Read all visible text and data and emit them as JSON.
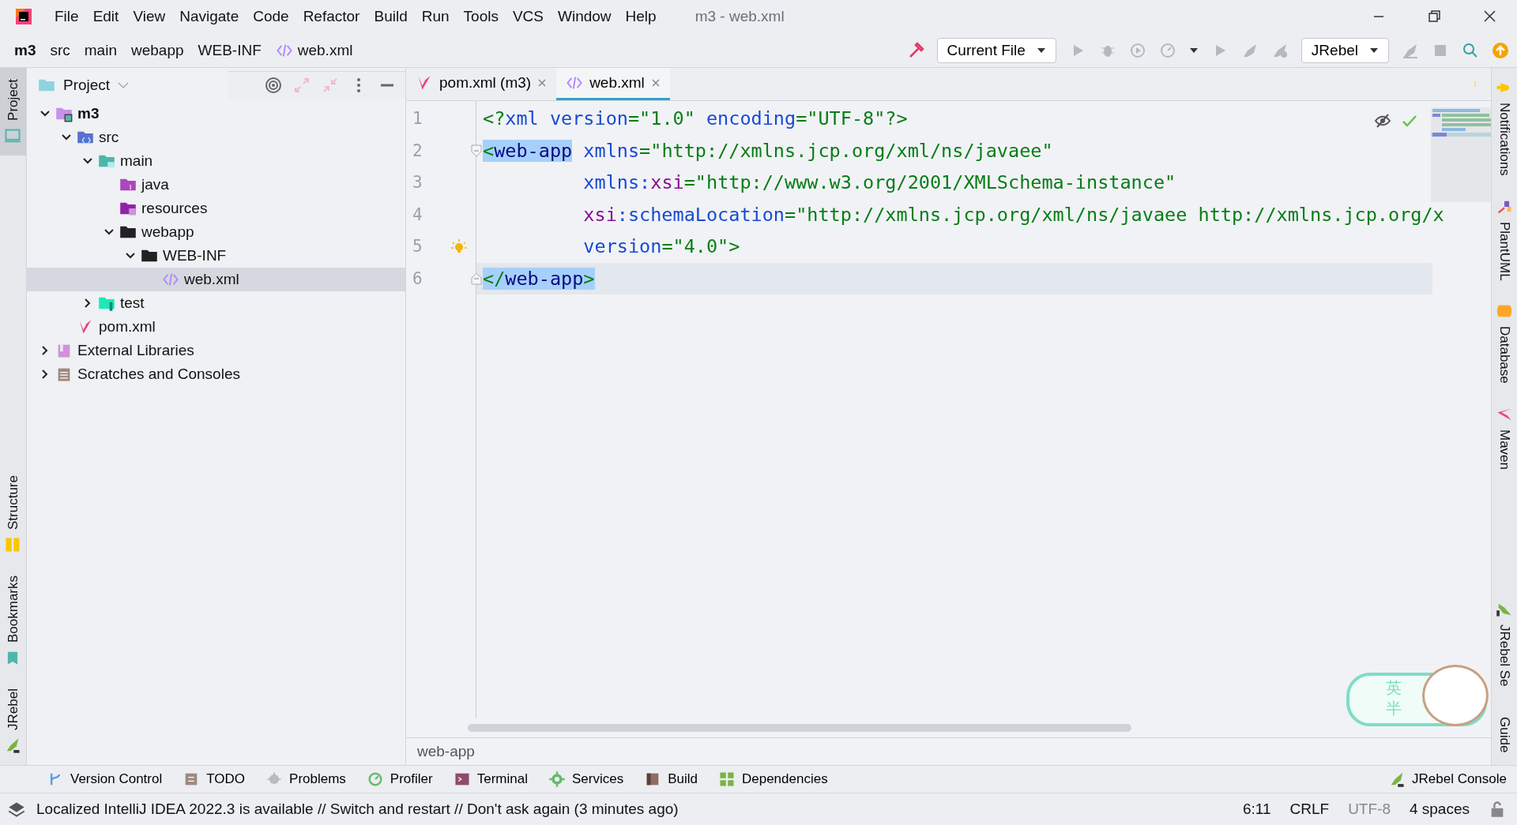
{
  "app_title": "m3 - web.xml",
  "menu": [
    "File",
    "Edit",
    "View",
    "Navigate",
    "Code",
    "Refactor",
    "Build",
    "Run",
    "Tools",
    "VCS",
    "Window",
    "Help"
  ],
  "breadcrumbs": [
    {
      "label": "m3",
      "kind": "project"
    },
    {
      "label": "src",
      "kind": "folder"
    },
    {
      "label": "main",
      "kind": "folder"
    },
    {
      "label": "webapp",
      "kind": "folder"
    },
    {
      "label": "WEB-INF",
      "kind": "folder"
    },
    {
      "label": "web.xml",
      "kind": "xml-file"
    }
  ],
  "run_config": "Current File",
  "jrebel_dropdown": "JRebel",
  "left_strip_top": [
    {
      "label": "Project",
      "kind": "project",
      "selected": true
    }
  ],
  "left_strip_bottom": [
    {
      "label": "Structure",
      "kind": "structure",
      "selected": false
    },
    {
      "label": "Bookmarks",
      "kind": "bookmarks",
      "selected": false
    },
    {
      "label": "JRebel",
      "kind": "jrebel",
      "selected": false
    }
  ],
  "project_panel": {
    "title": "Project",
    "tree": [
      {
        "label": "m3",
        "kind": "module",
        "expanded": true,
        "selected": false,
        "children": [
          {
            "label": "src",
            "kind": "source-folder",
            "expanded": true,
            "selected": false,
            "children": [
              {
                "label": "main",
                "kind": "main-folder",
                "expanded": true,
                "selected": false,
                "children": [
                  {
                    "label": "java",
                    "kind": "java-root",
                    "selected": false
                  },
                  {
                    "label": "resources",
                    "kind": "resources-root",
                    "selected": false
                  },
                  {
                    "label": "webapp",
                    "kind": "folder",
                    "expanded": true,
                    "selected": false,
                    "children": [
                      {
                        "label": "WEB-INF",
                        "kind": "folder",
                        "expanded": true,
                        "selected": false,
                        "children": [
                          {
                            "label": "web.xml",
                            "kind": "xml-file",
                            "selected": true
                          }
                        ]
                      }
                    ]
                  }
                ]
              },
              {
                "label": "test",
                "kind": "test-root",
                "expanded": false,
                "selected": false
              }
            ]
          },
          {
            "label": "pom.xml",
            "kind": "maven-file",
            "selected": false
          }
        ]
      },
      {
        "label": "External Libraries",
        "kind": "libraries",
        "expanded": false,
        "selected": false
      },
      {
        "label": "Scratches and Consoles",
        "kind": "scratches",
        "expanded": false,
        "selected": false
      }
    ]
  },
  "editor_tabs": [
    {
      "label": "pom.xml (m3)",
      "kind": "maven-file",
      "selected": false
    },
    {
      "label": "web.xml",
      "kind": "xml-file",
      "selected": true
    }
  ],
  "code_lines": [
    {
      "number": "1",
      "current": false,
      "kind": "plain",
      "segments": [
        {
          "t": "<?",
          "kind": "punct",
          "highlighted": false
        },
        {
          "t": "xml version",
          "kind": "attr",
          "highlighted": false
        },
        {
          "t": "=\"1.0\"",
          "kind": "value",
          "highlighted": false
        },
        {
          "t": " encoding",
          "kind": "attr",
          "highlighted": false
        },
        {
          "t": "=\"UTF-8\"?>",
          "kind": "value",
          "highlighted": false
        }
      ]
    },
    {
      "number": "2",
      "current": false,
      "kind": "fold-start",
      "segments": [
        {
          "t": "<",
          "kind": "punct",
          "highlighted": true
        },
        {
          "t": "web-app",
          "kind": "tag",
          "highlighted": true
        },
        {
          "t": " xmlns",
          "kind": "attr",
          "highlighted": false
        },
        {
          "t": "=\"http://xmlns.jcp.org/xml/ns/javaee\"",
          "kind": "value",
          "highlighted": false
        }
      ]
    },
    {
      "number": "3",
      "current": false,
      "kind": "plain",
      "segments": [
        {
          "t": "         xmlns:",
          "kind": "attr",
          "highlighted": false
        },
        {
          "t": "xsi",
          "kind": "ns",
          "highlighted": false
        },
        {
          "t": "=\"http://www.w3.org/2001/XMLSchema-instance\"",
          "kind": "value",
          "highlighted": false
        }
      ]
    },
    {
      "number": "4",
      "current": false,
      "kind": "plain",
      "segments": [
        {
          "t": "         xsi",
          "kind": "ns",
          "highlighted": false
        },
        {
          "t": ":schemaLocation",
          "kind": "attr",
          "highlighted": false
        },
        {
          "t": "=\"http://xmlns.jcp.org/xml/ns/javaee http://xmlns.jcp.org/x",
          "kind": "value",
          "highlighted": false
        }
      ]
    },
    {
      "number": "5",
      "current": false,
      "kind": "intention",
      "segments": [
        {
          "t": "         version",
          "kind": "attr",
          "highlighted": false
        },
        {
          "t": "=\"4.0\">",
          "kind": "value",
          "highlighted": false
        }
      ]
    },
    {
      "number": "6",
      "current": true,
      "kind": "fold-end",
      "segments": [
        {
          "t": "</",
          "kind": "punct",
          "highlighted": true
        },
        {
          "t": "web-app",
          "kind": "tag",
          "highlighted": true
        },
        {
          "t": ">",
          "kind": "punct",
          "highlighted": true
        }
      ]
    }
  ],
  "editor_breadcrumb": "web-app",
  "right_strip": [
    {
      "label": "Notifications",
      "kind": "bell"
    },
    {
      "label": "PlantUML",
      "kind": "plantuml"
    },
    {
      "label": "Database",
      "kind": "database"
    },
    {
      "label": "Maven",
      "kind": "maven"
    }
  ],
  "right_strip_bottom": {
    "label": "JRebel Se",
    "kind": "jrebel",
    "tail": "Guide"
  },
  "floating_widget": {
    "chars": [
      "英",
      "半"
    ]
  },
  "tool_windows": [
    {
      "label": "Version Control",
      "kind": "vcs"
    },
    {
      "label": "TODO",
      "kind": "todo"
    },
    {
      "label": "Problems",
      "kind": "problems"
    },
    {
      "label": "Profiler",
      "kind": "profiler"
    },
    {
      "label": "Terminal",
      "kind": "terminal"
    },
    {
      "label": "Services",
      "kind": "services"
    },
    {
      "label": "Build",
      "kind": "build"
    },
    {
      "label": "Dependencies",
      "kind": "dependencies"
    }
  ],
  "jrebel_console": "JRebel Console",
  "status": {
    "message": "Localized IntelliJ IDEA 2022.3 is available // Switch and restart // Don't ask again (3 minutes ago)",
    "items": [
      {
        "label": "6:11",
        "disabled": false
      },
      {
        "label": "CRLF",
        "disabled": false
      },
      {
        "label": "UTF-8",
        "disabled": true
      },
      {
        "label": "4 spaces",
        "disabled": false
      }
    ]
  }
}
